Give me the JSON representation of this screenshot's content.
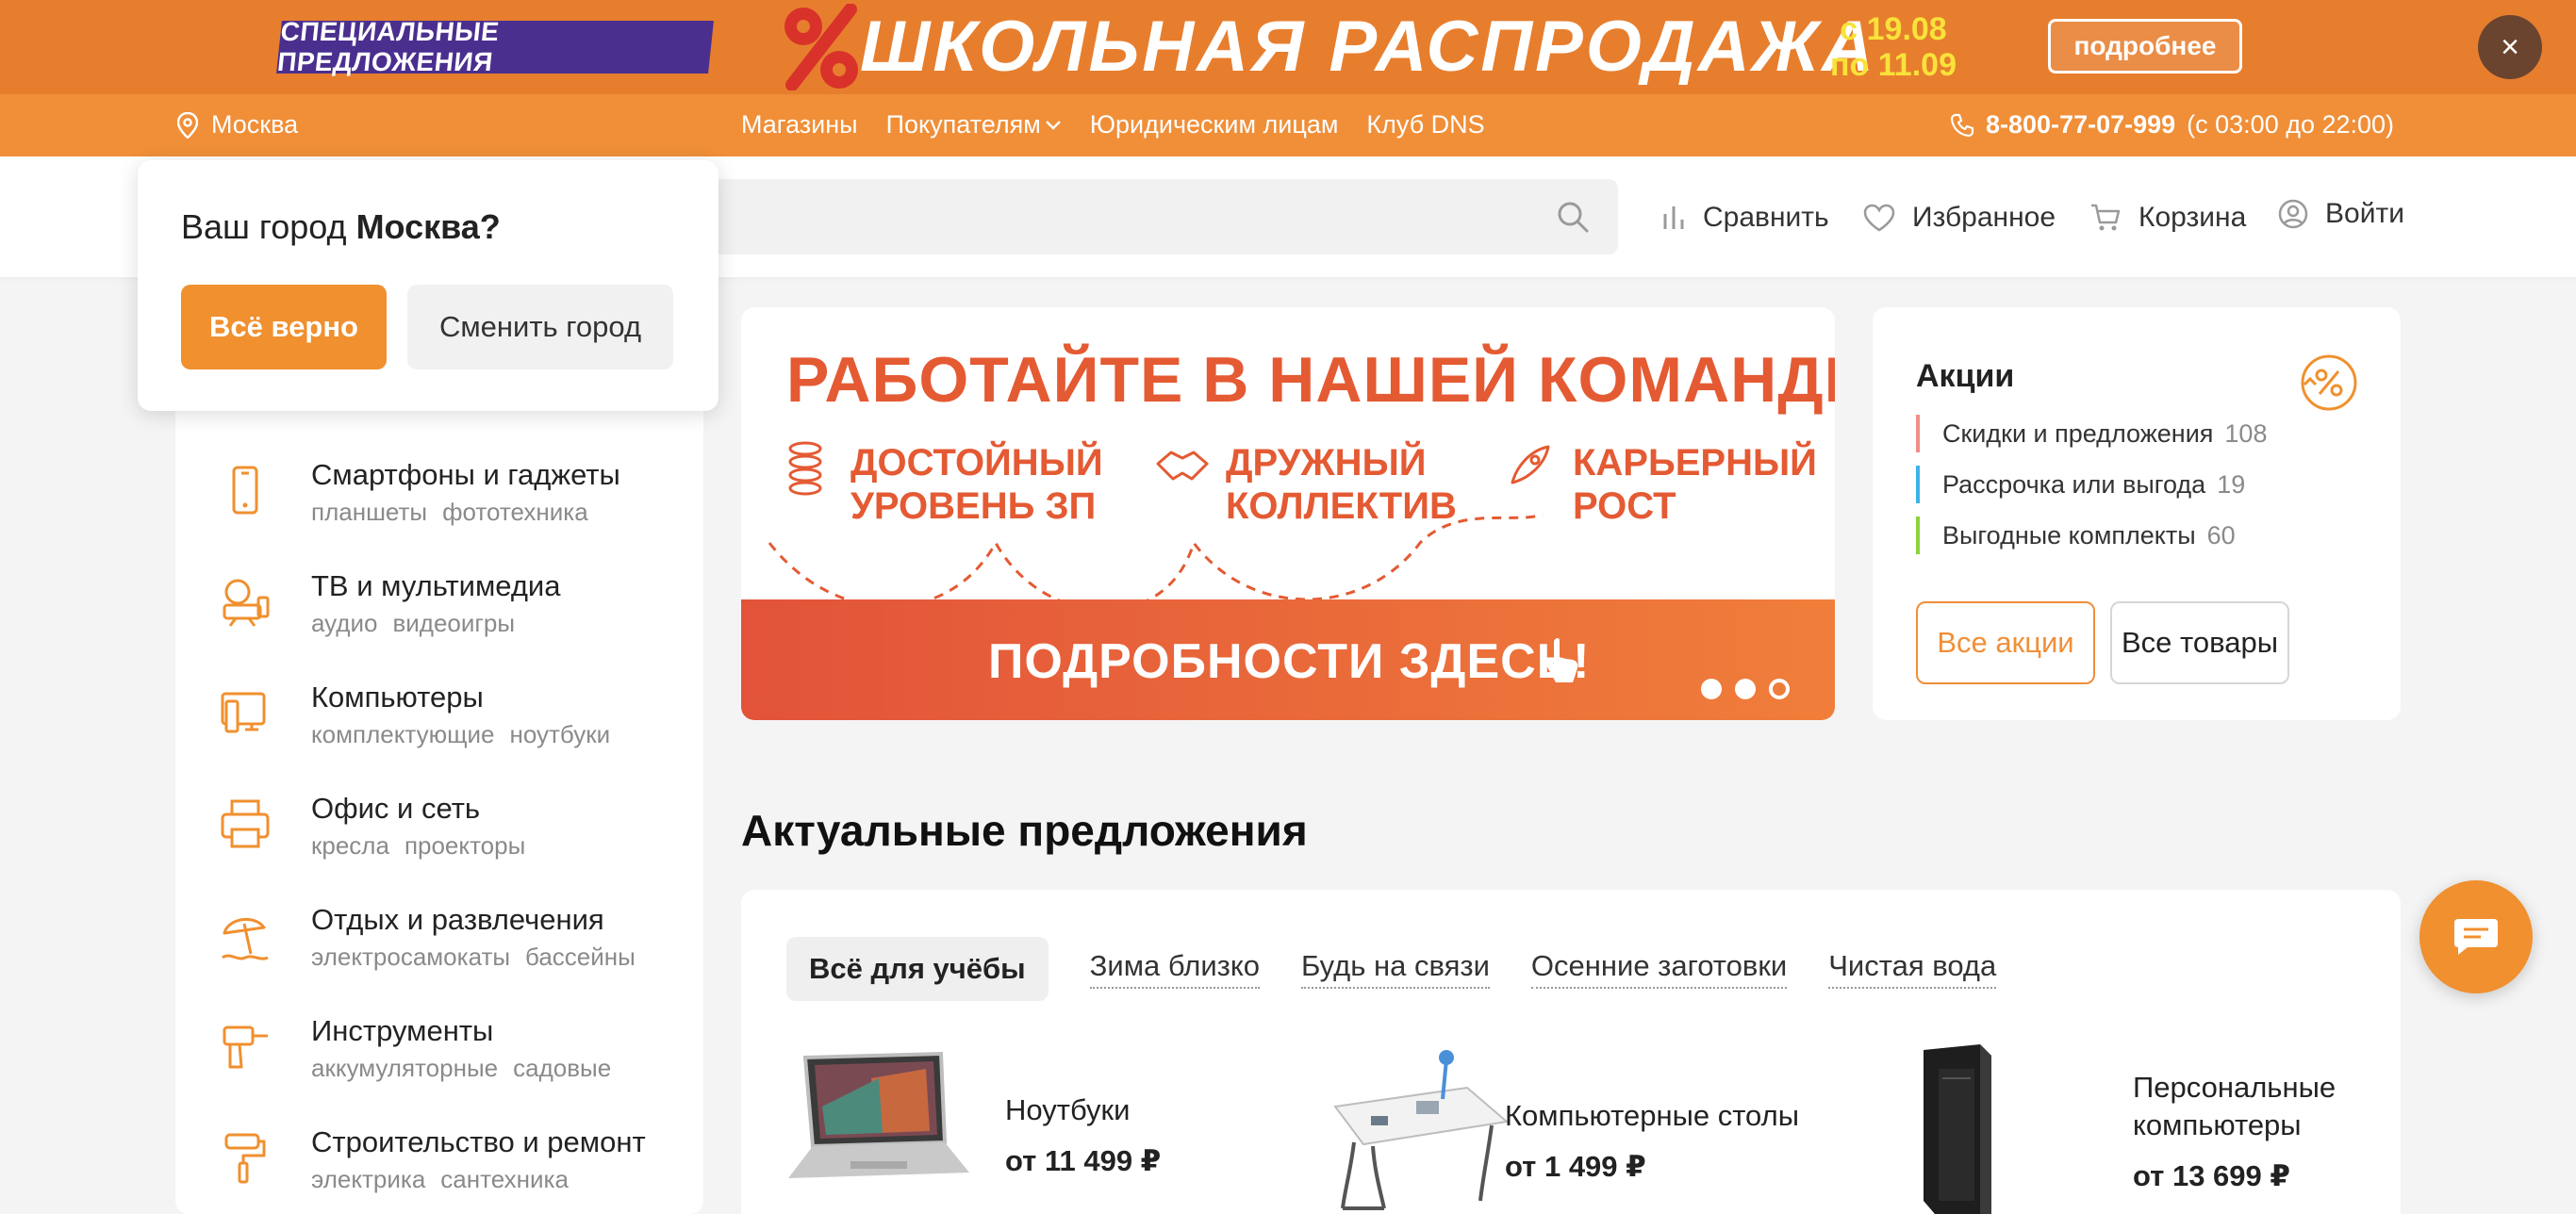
{
  "promo": {
    "special": "СПЕЦИАЛЬНЫЕ ПРЕДЛОЖЕНИЯ",
    "title": "ШКОЛЬНАЯ РАСПРОДАЖА",
    "date_from": "с 19.08",
    "date_to": "по 11.09",
    "more": "подробнее",
    "close": "×"
  },
  "topnav": {
    "city": "Москва",
    "links": [
      "Магазины",
      "Покупателям",
      "Юридическим лицам",
      "Клуб DNS"
    ],
    "phone": "8-800-77-07-999",
    "hours": "(с 03:00 до 22:00)"
  },
  "header": {
    "search_placeholder": "",
    "compare": "Сравнить",
    "favorites": "Избранное",
    "cart": "Корзина",
    "login": "Войти"
  },
  "city_popup": {
    "question": "Ваш город",
    "city": "Москва?",
    "confirm": "Всё верно",
    "change": "Сменить город"
  },
  "categories": [
    {
      "title": "Смартфоны и гаджеты",
      "sub1": "планшеты",
      "sub2": "фототехника",
      "icon": "smartphone-icon"
    },
    {
      "title": "ТВ и мультимедиа",
      "sub1": "аудио",
      "sub2": "видеоигры",
      "icon": "tv-icon"
    },
    {
      "title": "Компьютеры",
      "sub1": "комплектующие",
      "sub2": "ноутбуки",
      "icon": "computer-icon"
    },
    {
      "title": "Офис и сеть",
      "sub1": "кресла",
      "sub2": "проекторы",
      "icon": "printer-icon"
    },
    {
      "title": "Отдых и развлечения",
      "sub1": "электросамокаты",
      "sub2": "бассейны",
      "icon": "umbrella-icon"
    },
    {
      "title": "Инструменты",
      "sub1": "аккумуляторные",
      "sub2": "садовые",
      "icon": "drill-icon"
    },
    {
      "title": "Строительство и ремонт",
      "sub1": "электрика",
      "sub2": "сантехника",
      "icon": "paint-roller-icon"
    }
  ],
  "hero": {
    "headline": "РАБОТАЙТЕ В НАШЕЙ КОМАНДЕ!",
    "f1a": "ДОСТОЙНЫЙ",
    "f1b": "УРОВЕНЬ ЗП",
    "f2a": "ДРУЖНЫЙ",
    "f2b": "КОЛЛЕКТИВ",
    "f3a": "КАРЬЕРНЫЙ",
    "f3b": "РОСТ",
    "cta": "ПОДРОБНОСТИ ЗДЕСЬ!"
  },
  "akcii": {
    "title": "Акции",
    "rows": [
      {
        "label": "Скидки и предложения",
        "count": "108",
        "color": "#f28b8b"
      },
      {
        "label": "Рассрочка или выгода",
        "count": "19",
        "color": "#3bb3e8"
      },
      {
        "label": "Выгодные комплекты",
        "count": "60",
        "color": "#8cd23c"
      }
    ],
    "all_promos": "Все акции",
    "all_goods": "Все товары"
  },
  "offers": {
    "title": "Актуальные предложения",
    "tabs": [
      "Всё для учёбы",
      "Зима близко",
      "Будь на связи",
      "Осенние заготовки",
      "Чистая вода"
    ],
    "products": [
      {
        "name": "Ноутбуки",
        "price": "от 11 499 ₽"
      },
      {
        "name": "Компьютерные столы",
        "price": "от 1 499 ₽"
      },
      {
        "name_line1": "Персональные",
        "name_line2": "компьютеры",
        "price": "от 13 699 ₽"
      }
    ]
  },
  "colors": {
    "brand": "#f08f38",
    "promo_bg": "#e77e2e",
    "accent_red": "#e45a33"
  }
}
